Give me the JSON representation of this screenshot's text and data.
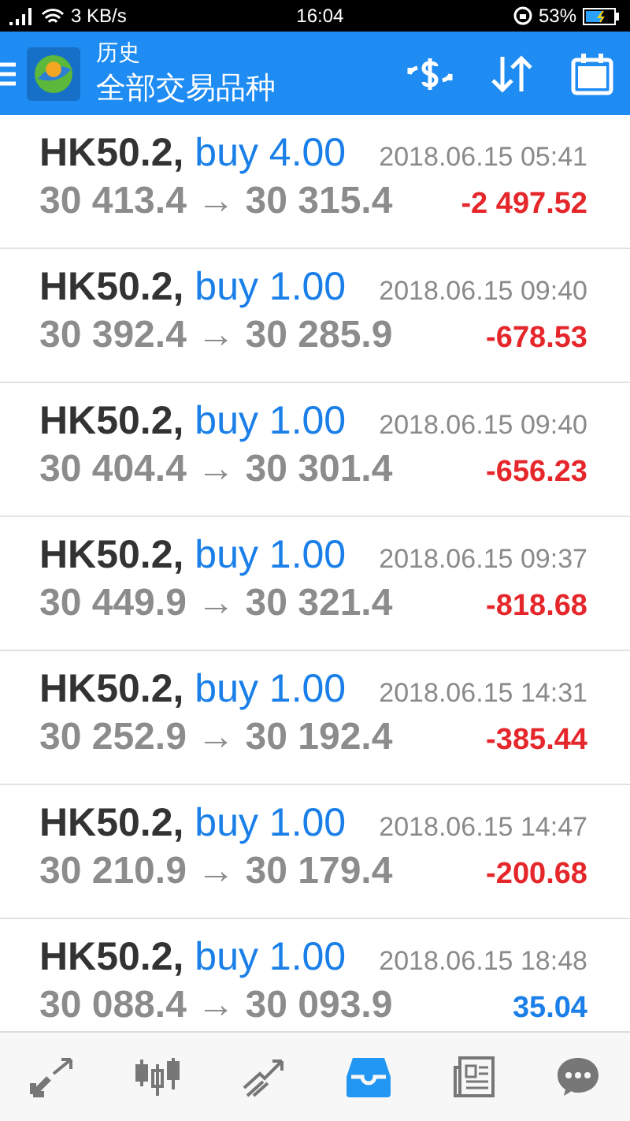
{
  "status_bar": {
    "speed": "3 KB/s",
    "time": "16:04",
    "battery": "53%"
  },
  "header": {
    "title": "历史",
    "subtitle": "全部交易品种"
  },
  "trades": [
    {
      "symbol": "HK50.2,",
      "action": "buy 4.00",
      "time": "2018.06.15 05:41",
      "prices": "30 413.4 → 30 315.4",
      "profit": "-2 497.52",
      "color": "#e5262a"
    },
    {
      "symbol": "HK50.2,",
      "action": "buy 1.00",
      "time": "2018.06.15 09:40",
      "prices": "30 392.4 → 30 285.9",
      "profit": "-678.53",
      "color": "#e5262a"
    },
    {
      "symbol": "HK50.2,",
      "action": "buy 1.00",
      "time": "2018.06.15 09:40",
      "prices": "30 404.4 → 30 301.4",
      "profit": "-656.23",
      "color": "#e5262a"
    },
    {
      "symbol": "HK50.2,",
      "action": "buy 1.00",
      "time": "2018.06.15 09:37",
      "prices": "30 449.9 → 30 321.4",
      "profit": "-818.68",
      "color": "#e5262a"
    },
    {
      "symbol": "HK50.2,",
      "action": "buy 1.00",
      "time": "2018.06.15 14:31",
      "prices": "30 252.9 → 30 192.4",
      "profit": "-385.44",
      "color": "#e5262a"
    },
    {
      "symbol": "HK50.2,",
      "action": "buy 1.00",
      "time": "2018.06.15 14:47",
      "prices": "30 210.9 → 30 179.4",
      "profit": "-200.68",
      "color": "#e5262a"
    },
    {
      "symbol": "HK50.2,",
      "action": "buy 1.00",
      "time": "2018.06.15 18:48",
      "prices": "30 088.4 → 30 093.9",
      "profit": "35.04",
      "color": "#1a7fe8"
    }
  ],
  "nav": [
    {
      "kind": "trade",
      "selected": false
    },
    {
      "kind": "chart",
      "selected": false
    },
    {
      "kind": "quotes",
      "selected": false
    },
    {
      "kind": "history",
      "selected": true
    },
    {
      "kind": "news",
      "selected": false
    },
    {
      "kind": "chat",
      "selected": false
    }
  ]
}
